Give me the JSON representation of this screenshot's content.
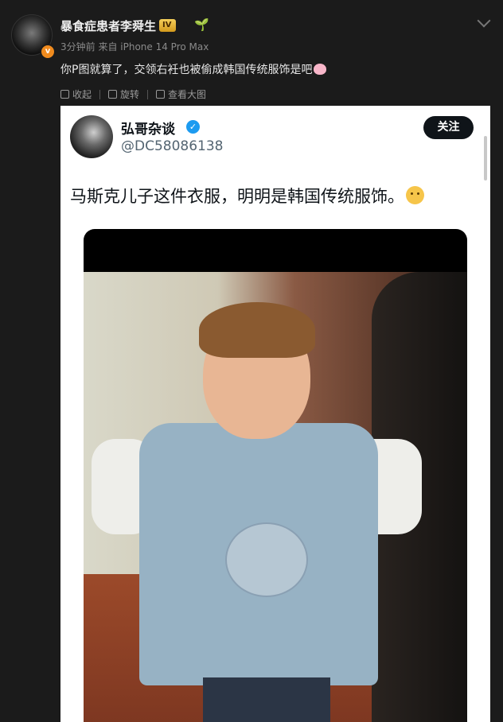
{
  "comment": {
    "username": "暴食症患者李舜生",
    "level_badge": "IV",
    "avatar_badge": "v",
    "meta": "3分钟前  来自 iPhone 14 Pro Max",
    "text": "你P图就算了，交领右衽也被偷成韩国传统服饰是吧",
    "actions": [
      {
        "label": "收起",
        "icon": "collapse-icon"
      },
      {
        "label": "旋转",
        "icon": "rotate-icon"
      },
      {
        "label": "查看大图",
        "icon": "view-large-icon"
      }
    ]
  },
  "tweet": {
    "name": "弘哥杂谈",
    "handle": "@DC58086138",
    "follow_label": "关注",
    "text": "马斯克儿子这件衣服，明明是韩国传统服饰。",
    "verified": true,
    "accent": "#1d9bf0"
  }
}
